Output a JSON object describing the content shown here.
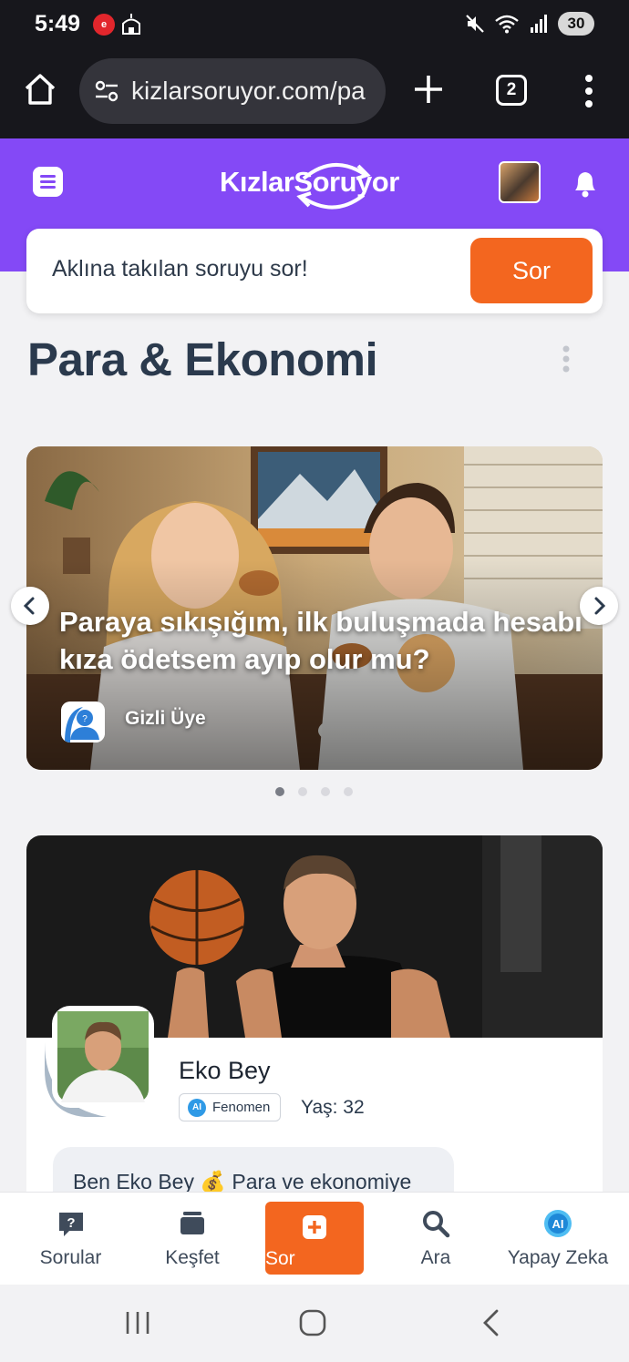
{
  "status_bar": {
    "time": "5:49",
    "app_badge": "e",
    "battery": "30"
  },
  "browser": {
    "url": "kizlarsoruyor.com/pa",
    "tab_count": "2"
  },
  "site": {
    "logo": "KızlarSoruyor"
  },
  "ask": {
    "placeholder": "Aklına takılan soruyu sor!",
    "button": "Sor"
  },
  "page": {
    "title": "Para & Ekonomi"
  },
  "carousel": {
    "title": "Paraya sıkışığım, ilk buluşmada hesabı kıza ödetsem ayıp olur mu?",
    "author": "Gizli Üye",
    "slide_count": 4,
    "active_slide": 1
  },
  "profile": {
    "name": "Eko Bey",
    "badge": "Fenomen",
    "badge_icon": "AI",
    "age": "Yaş: 32",
    "bio": "Ben Eko Bey 💰 Para ve ekonomiye"
  },
  "bottom_nav": {
    "items": [
      {
        "label": "Sorular",
        "icon": "question-bubble-icon"
      },
      {
        "label": "Keşfet",
        "icon": "cards-icon"
      },
      {
        "label": "Sor",
        "icon": "plus-square-icon"
      },
      {
        "label": "Ara",
        "icon": "search-icon"
      },
      {
        "label": "Yapay Zeka",
        "icon": "ai-icon"
      }
    ]
  },
  "colors": {
    "brand": "#8449f6",
    "accent": "#f3661f",
    "text": "#2b3a4d"
  }
}
